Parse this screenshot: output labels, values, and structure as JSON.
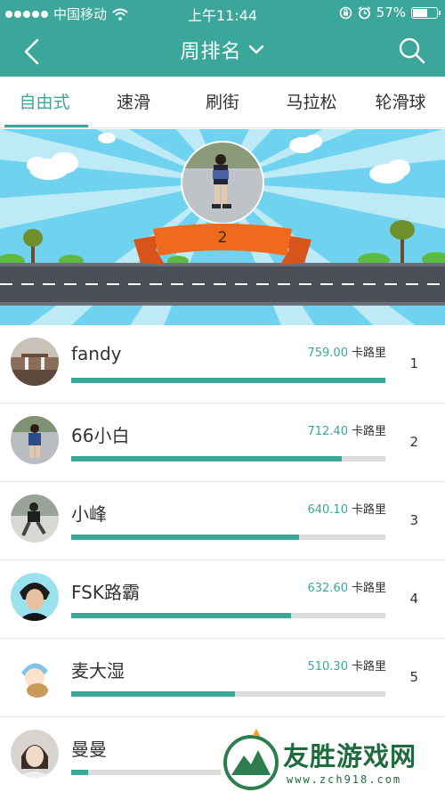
{
  "status_bar": {
    "carrier": "中国移动",
    "time": "上午11:44",
    "battery": "57%",
    "battery_level": 0.57
  },
  "nav": {
    "title": "周排名",
    "back_icon": "chevron-left-icon",
    "dropdown_icon": "chevron-down-icon",
    "search_icon": "search-icon"
  },
  "tabs": [
    {
      "label": "自由式",
      "active": true
    },
    {
      "label": "速滑",
      "active": false
    },
    {
      "label": "刷街",
      "active": false
    },
    {
      "label": "马拉松",
      "active": false
    },
    {
      "label": "轮滑球",
      "active": false
    }
  ],
  "banner": {
    "rank_label": "2"
  },
  "leaderboard": [
    {
      "name": "fandy",
      "value": "759.00",
      "unit": "卡路里",
      "rank": "1",
      "progress": 1.0
    },
    {
      "name": "66小白",
      "value": "712.40",
      "unit": "卡路里",
      "rank": "2",
      "progress": 0.86
    },
    {
      "name": "小峰",
      "value": "640.10",
      "unit": "卡路里",
      "rank": "3",
      "progress": 0.726
    },
    {
      "name": "FSK路霸",
      "value": "632.60",
      "unit": "卡路里",
      "rank": "4",
      "progress": 0.701
    },
    {
      "name": "麦大湿",
      "value": "510.30",
      "unit": "卡路里",
      "rank": "5",
      "progress": 0.521
    },
    {
      "name": "曼曼",
      "value": "",
      "unit": "",
      "rank": "",
      "progress": 0.11
    }
  ],
  "watermark": {
    "text": "友胜游戏网",
    "url": "www.zch918.com"
  },
  "colors": {
    "accent": "#3aa79a",
    "bar_track": "#dcdcdc",
    "ribbon": "#f06a1e",
    "sky": "#6fd2ee"
  }
}
